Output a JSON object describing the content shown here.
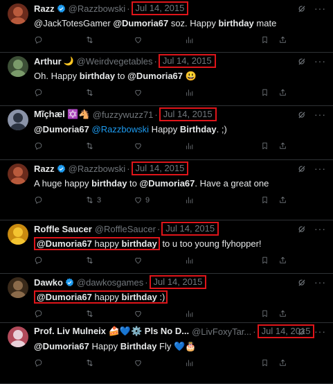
{
  "tweets": [
    {
      "name": "Razz",
      "emoji": "",
      "verified": true,
      "handle": "@Razzbowski",
      "date": "Jul 14, 2015",
      "avatar": "razz",
      "body": [
        {
          "t": "@JackTotesGamer ",
          "s": "plain"
        },
        {
          "t": "@Dumoria67",
          "s": "bold"
        },
        {
          "t": " soz. Happy ",
          "s": "plain"
        },
        {
          "t": "birthday",
          "s": "bold"
        },
        {
          "t": " mate",
          "s": "plain"
        }
      ],
      "retweets": "",
      "likes": "",
      "highlight": false
    },
    {
      "name": "Arthur",
      "emoji": "🌙",
      "verified": false,
      "handle": "@Weirdvegetables",
      "date": "Jul 14, 2015",
      "avatar": "arthur",
      "body": [
        {
          "t": "Oh. Happy ",
          "s": "plain"
        },
        {
          "t": "birthday",
          "s": "bold"
        },
        {
          "t": " to ",
          "s": "plain"
        },
        {
          "t": "@Dumoria67",
          "s": "bold"
        },
        {
          "t": " 😃",
          "s": "plain"
        }
      ],
      "retweets": "",
      "likes": "",
      "highlight": false
    },
    {
      "name": "Mĩçhæl ✡️🐴",
      "emoji": "",
      "verified": false,
      "handle": "@fuzzywuzz71",
      "date": "Jul 14, 2015",
      "avatar": "michael",
      "body": [
        {
          "t": "@Dumoria67",
          "s": "bold"
        },
        {
          "t": " ",
          "s": "plain"
        },
        {
          "t": "@Razzbowski",
          "s": "link"
        },
        {
          "t": " Happy ",
          "s": "plain"
        },
        {
          "t": "Birthday",
          "s": "bold"
        },
        {
          "t": ". ;)",
          "s": "plain"
        }
      ],
      "retweets": "",
      "likes": "",
      "highlight": false
    },
    {
      "name": "Razz",
      "emoji": "",
      "verified": true,
      "handle": "@Razzbowski",
      "date": "Jul 14, 2015",
      "avatar": "razz",
      "body": [
        {
          "t": "A huge happy ",
          "s": "plain"
        },
        {
          "t": "birthday",
          "s": "bold"
        },
        {
          "t": " to ",
          "s": "plain"
        },
        {
          "t": "@Dumoria67",
          "s": "bold"
        },
        {
          "t": ". Have a great one",
          "s": "plain"
        }
      ],
      "retweets": "3",
      "likes": "9",
      "highlight": false
    },
    {
      "name": "Roffle Saucer",
      "emoji": "",
      "verified": false,
      "handle": "@RoffleSaucer",
      "date": "Jul 14, 2015",
      "avatar": "roffle",
      "body_highlight": [
        {
          "t": "@Dumoria67",
          "s": "bold"
        },
        {
          "t": " happy ",
          "s": "plain"
        },
        {
          "t": "birthday",
          "s": "bold"
        }
      ],
      "body": [
        {
          "t": " to u too young flyhopper!",
          "s": "plain"
        }
      ],
      "retweets": "",
      "likes": "",
      "highlight": true
    },
    {
      "name": "Dawko",
      "emoji": "",
      "verified": true,
      "handle": "@dawkosgames",
      "date": "Jul 14, 2015",
      "avatar": "dawko",
      "body_highlight": [
        {
          "t": "@Dumoria67",
          "s": "bold"
        },
        {
          "t": " happy ",
          "s": "plain"
        },
        {
          "t": "birthday",
          "s": "bold"
        },
        {
          "t": " :)",
          "s": "plain"
        }
      ],
      "body": [],
      "retweets": "",
      "likes": "",
      "highlight": true
    },
    {
      "name": "Prof. Liv Mulneix 🍰💙⚙️ Pls No D...",
      "emoji": "",
      "verified": false,
      "handle": "@LivFoxyTar...",
      "date": "Jul 14, 2015",
      "avatar": "liv",
      "body": [
        {
          "t": "@Dumoria67",
          "s": "bold"
        },
        {
          "t": " Happy ",
          "s": "plain"
        },
        {
          "t": "Birthday",
          "s": "bold"
        },
        {
          "t": " Fly 💙🎂",
          "s": "plain"
        }
      ],
      "retweets": "",
      "likes": "",
      "highlight": false
    }
  ]
}
